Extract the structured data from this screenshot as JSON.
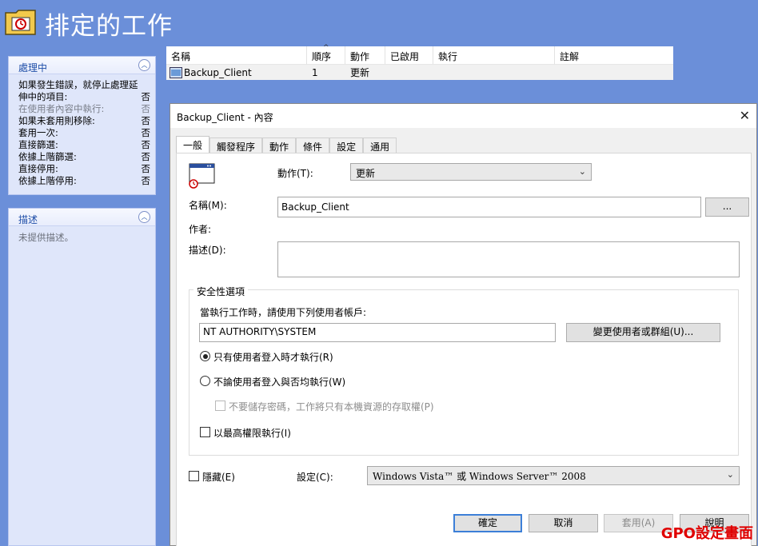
{
  "header": {
    "title": "排定的工作"
  },
  "panes": {
    "processing": {
      "title": "處理中",
      "rows": [
        {
          "label": "如果發生錯誤，就停止處理延伸中的項目:",
          "value": "否",
          "dim": false
        },
        {
          "label": "在使用者內容中執行:",
          "value": "否",
          "dim": true
        },
        {
          "label": "如果未套用則移除:",
          "value": "否",
          "dim": false
        },
        {
          "label": "套用一次:",
          "value": "否",
          "dim": false
        },
        {
          "label": "直接篩選:",
          "value": "否",
          "dim": false
        },
        {
          "label": "依據上階篩選:",
          "value": "否",
          "dim": false
        },
        {
          "label": "直接停用:",
          "value": "否",
          "dim": false
        },
        {
          "label": "依據上階停用:",
          "value": "否",
          "dim": false
        }
      ]
    },
    "description": {
      "title": "描述",
      "text": "未提供描述。"
    }
  },
  "list": {
    "columns": [
      "名稱",
      "順序",
      "動作",
      "已啟用",
      "執行",
      "註解"
    ],
    "rows": [
      {
        "name": "Backup_Client",
        "order": "1",
        "action": "更新",
        "enabled": "",
        "run": "",
        "comment": ""
      }
    ]
  },
  "dialog": {
    "title": "Backup_Client - 內容",
    "close": "✕",
    "tabs": [
      "一般",
      "觸發程序",
      "動作",
      "條件",
      "設定",
      "通用"
    ],
    "action_label": "動作(T):",
    "action_value": "更新",
    "name_label": "名稱(M):",
    "name_value": "Backup_Client",
    "browse_label": "...",
    "author_label": "作者:",
    "desc_label": "描述(D):",
    "security": {
      "title": "安全性選項",
      "account_prompt": "當執行工作時，請使用下列使用者帳戶:",
      "account_value": "NT AUTHORITY\\SYSTEM",
      "change_user": "變更使用者或群組(U)...",
      "radio_logged_on": "只有使用者登入時才執行(R)",
      "radio_any": "不論使用者登入與否均執行(W)",
      "no_store_password": "不要儲存密碼，工作將只有本機資源的存取權(P)",
      "highest_privileges": "以最高權限執行(I)"
    },
    "hidden_label": "隱藏(E)",
    "config_label": "設定(C):",
    "config_value": "Windows Vista™ 或 Windows Server™ 2008",
    "buttons": {
      "ok": "確定",
      "cancel": "取消",
      "apply": "套用(A)",
      "help": "說明"
    }
  },
  "watermark": "GPO設定畫面"
}
